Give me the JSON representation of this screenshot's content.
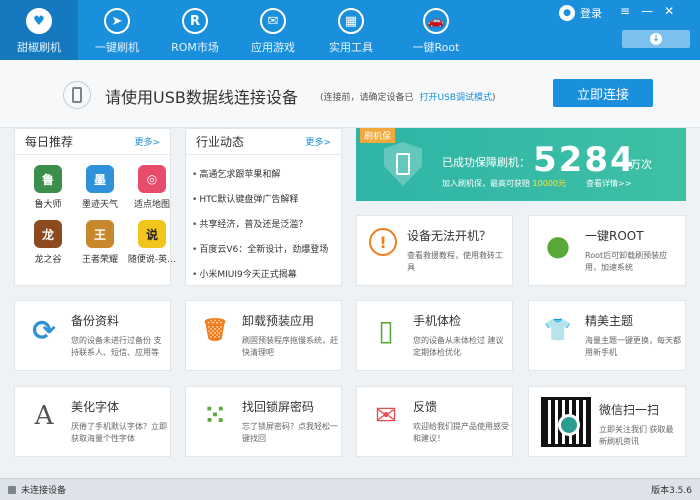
{
  "nav": {
    "items": [
      {
        "label": "甜椒刷机",
        "icon": "pepper-icon",
        "glyph": "♥"
      },
      {
        "label": "一键刷机",
        "icon": "cursor-icon",
        "glyph": "➤"
      },
      {
        "label": "ROM市场",
        "icon": "rom-icon",
        "glyph": "R"
      },
      {
        "label": "应用游戏",
        "icon": "mail-icon",
        "glyph": "✉"
      },
      {
        "label": "实用工具",
        "icon": "grid-icon",
        "glyph": "▦"
      },
      {
        "label": "一键Root",
        "icon": "car-icon",
        "glyph": "🚗"
      }
    ],
    "login_label": "登录"
  },
  "connect": {
    "title": "请使用USB数据线连接设备",
    "hint": "(连接前，请确定设备已",
    "hint_link": "打开USB调试模式",
    "hint_close": ")",
    "button": "立即连接"
  },
  "daily": {
    "title": "每日推荐",
    "more": "更多>",
    "apps": [
      {
        "name": "鲁大师",
        "color": "#3b8f4b",
        "glyph": "鲁"
      },
      {
        "name": "墨迹天气",
        "color": "#2f92d8",
        "glyph": "墨"
      },
      {
        "name": "适点地图",
        "color": "#e84c6d",
        "glyph": "◎"
      },
      {
        "name": "龙之谷",
        "color": "#8c4a1e",
        "glyph": "龙"
      },
      {
        "name": "王者荣耀",
        "color": "#c8872a",
        "glyph": "王"
      },
      {
        "name": "随便说-英…",
        "color": "#f3c41b",
        "glyph": "说"
      }
    ]
  },
  "industry": {
    "title": "行业动态",
    "more": "更多>",
    "news": [
      "高通乞求跟苹果和解",
      "HTC默认键盘弹广告解释",
      "共享经济，普及还是泛滥？",
      "百度云V6：全新设计，劲爆登场",
      "小米MIUI9今天正式揭幕"
    ]
  },
  "protect": {
    "tag": "刷机保",
    "title": "已成功保障刷机：",
    "count": "5284",
    "unit": "万次",
    "sub": "加入刷机保，最高可获赔",
    "reward": "10000元",
    "detail": "查看详情>>"
  },
  "features": [
    {
      "title": "设备无法开机？",
      "desc": "查看救援教程，使用救砖工具",
      "icon": "alert-icon",
      "glyph": "!",
      "color": "#f07d1e"
    },
    {
      "title": "一键ROOT",
      "desc": "Root后可卸载刷预装应用，加速系统",
      "icon": "robot-icon",
      "glyph": "●",
      "color": "#5aa83a"
    },
    {
      "title": "备份资料",
      "desc": "您的设备未进行过备份 支持联系人、短信、应用等",
      "icon": "sync-icon",
      "glyph": "⟳",
      "color": "#2f92d8"
    },
    {
      "title": "卸载预装应用",
      "desc": "刷固预装程序拖慢系统，赶快清理吧",
      "icon": "trash-icon",
      "glyph": "🗑",
      "color": "#f07d1e"
    },
    {
      "title": "手机体检",
      "desc": "您的设备从未体检过 建议定期体检优化",
      "icon": "phone-check-icon",
      "glyph": "▯",
      "color": "#5aa83a"
    },
    {
      "title": "精美主题",
      "desc": "海量主题一键更换，每天都用新手机",
      "icon": "tshirt-icon",
      "glyph": "👕",
      "color": "#8c46b4"
    },
    {
      "title": "美化字体",
      "desc": "厌倦了手机默认字体？立即获取海量个性字体",
      "icon": "font-icon",
      "glyph": "A",
      "color": "#555555"
    },
    {
      "title": "找回锁屏密码",
      "desc": "忘了锁屏密码？点我轻松一键找回",
      "icon": "pattern-icon",
      "glyph": "⁙",
      "color": "#5aa83a"
    },
    {
      "title": "反馈",
      "desc": "欢迎给我们提产品使用感受和建议！",
      "icon": "envelope-icon",
      "glyph": "✉",
      "color": "#e84c4c"
    },
    {
      "title": "微信扫一扫",
      "desc": "立即关注我们 获取最新刷机资讯",
      "icon": "qr-code-icon",
      "glyph": "",
      "color": "#111111"
    }
  ],
  "status": {
    "left": "未连接设备",
    "version": "版本3.5.6"
  }
}
